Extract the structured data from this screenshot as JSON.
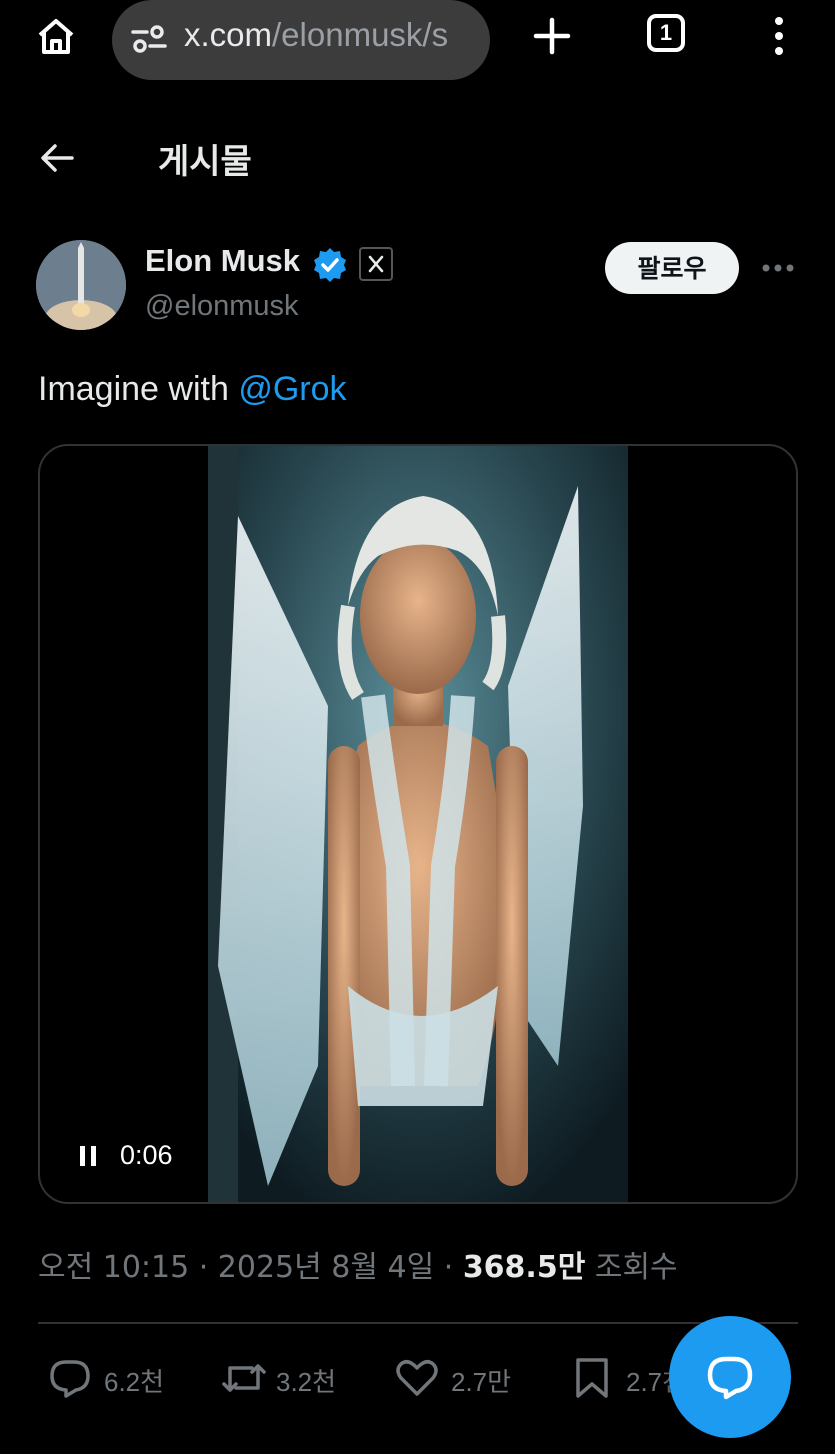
{
  "browser": {
    "url_domain": "x.com",
    "url_path": "/elonmusk/s",
    "tab_count": "1",
    "icons": [
      "home-icon",
      "tune-icon",
      "plus-icon",
      "tabs-icon",
      "menu-icon"
    ]
  },
  "header": {
    "title": "게시물"
  },
  "post": {
    "author_name": "Elon Musk",
    "author_handle": "@elonmusk",
    "follow_label": "팔로우",
    "text_prefix": "Imagine with ",
    "mention": "@Grok",
    "video_time": "0:06",
    "timestamp": "오전 10:15 · 2025년 8월 4일 · ",
    "views_count": "368.5만",
    "views_label": " 조회수"
  },
  "actions": {
    "replies": "6.2천",
    "reposts": "3.2천",
    "likes": "2.7만",
    "bookmarks": "2.7천"
  },
  "colors": {
    "accent": "#1d9bf0",
    "background": "#000000",
    "secondary_text": "#71767b"
  }
}
